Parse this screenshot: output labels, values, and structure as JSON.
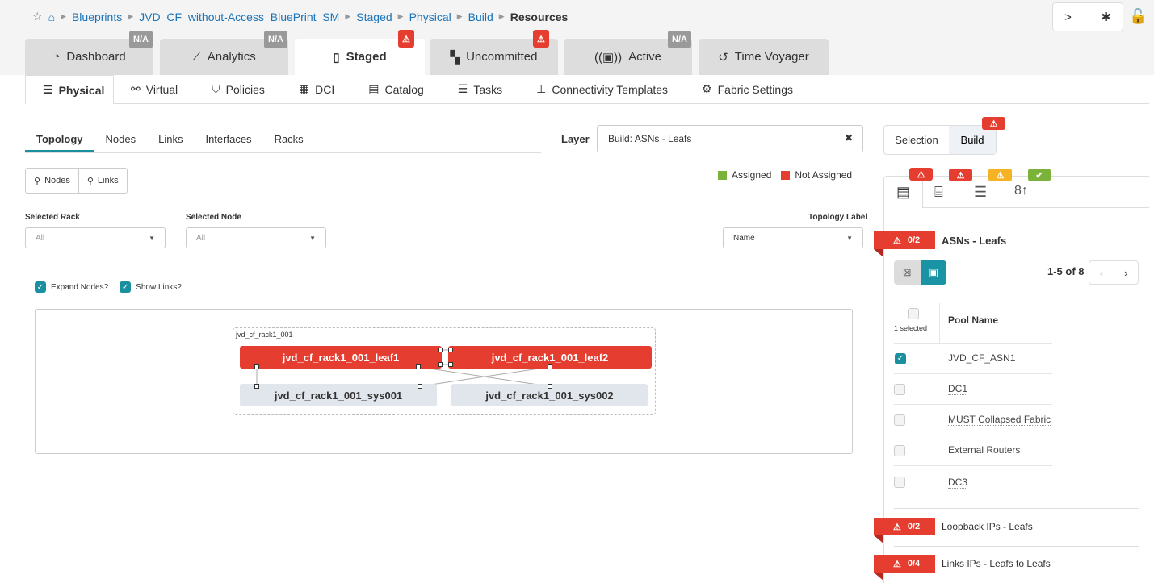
{
  "breadcrumb": [
    "Blueprints",
    "JVD_CF_without-Access_BluePrint_SM",
    "Staged",
    "Physical",
    "Build"
  ],
  "breadcrumb_current": "Resources",
  "tabs": [
    {
      "label": "Dashboard",
      "badge": "N/A"
    },
    {
      "label": "Analytics",
      "badge": "N/A"
    },
    {
      "label": "Staged",
      "badge": "!"
    },
    {
      "label": "Uncommitted",
      "badge": "!"
    },
    {
      "label": "Active",
      "badge": "N/A"
    },
    {
      "label": "Time Voyager"
    }
  ],
  "subnav": [
    "Physical",
    "Virtual",
    "Policies",
    "DCI",
    "Catalog",
    "Tasks",
    "Connectivity Templates",
    "Fabric Settings"
  ],
  "topo_tabs": [
    "Topology",
    "Nodes",
    "Links",
    "Interfaces",
    "Racks"
  ],
  "layer": {
    "label": "Layer",
    "value": "Build: ASNs - Leafs"
  },
  "search_buttons": {
    "nodes": "Nodes",
    "links": "Links"
  },
  "legend": {
    "assigned": "Assigned",
    "not_assigned": "Not Assigned",
    "assigned_color": "#7bb33a",
    "not_assigned_color": "#e53e30"
  },
  "filters": {
    "rack_label": "Selected Rack",
    "rack_value": "All",
    "node_label": "Selected Node",
    "node_value": "All",
    "topo_label": "Topology Label",
    "topo_value": "Name"
  },
  "options": {
    "expand": "Expand Nodes?",
    "show_links": "Show Links?"
  },
  "topology": {
    "rack": "jvd_cf_rack1_001",
    "leaf1": "jvd_cf_rack1_001_leaf1",
    "leaf2": "jvd_cf_rack1_001_leaf2",
    "sys1": "jvd_cf_rack1_001_sys001",
    "sys2": "jvd_cf_rack1_001_sys002"
  },
  "right": {
    "selection": "Selection",
    "build": "Build",
    "asn_count": "0/2",
    "asn_title": "ASNs - Leafs",
    "pagination": "1-5 of 8",
    "selected": "1 selected",
    "col": "Pool Name",
    "pools": [
      {
        "name": "JVD_CF_ASN1",
        "checked": true
      },
      {
        "name": "DC1"
      },
      {
        "name": "MUST Collapsed Fabric"
      },
      {
        "name": "External Routers"
      },
      {
        "name": "DC3"
      }
    ],
    "loop_count": "0/2",
    "loop_title": "Loopback IPs - Leafs",
    "links_count": "0/4",
    "links_title": "Links IPs - Leafs to Leafs"
  }
}
